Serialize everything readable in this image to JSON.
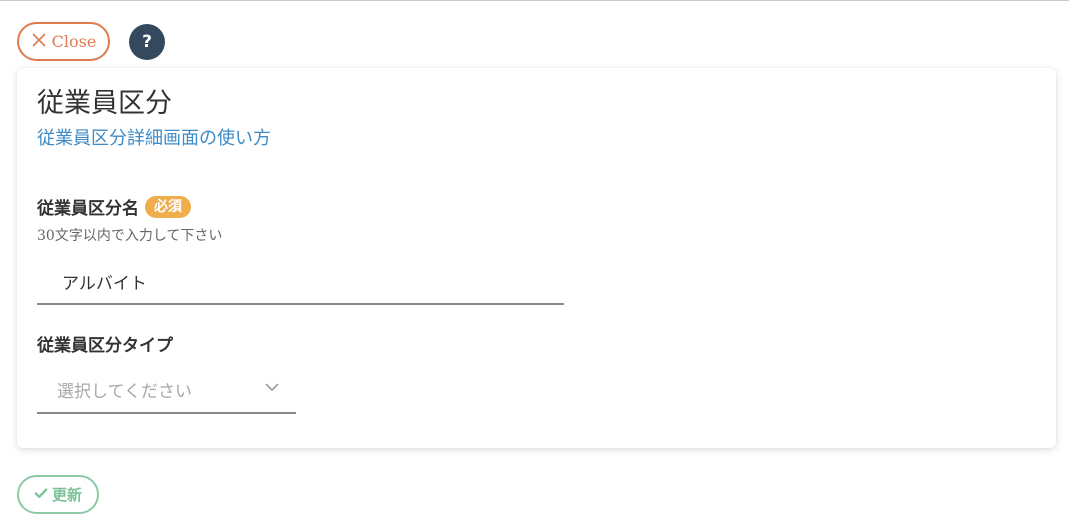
{
  "toolbar": {
    "close_label": "Close",
    "help_label": "?"
  },
  "page": {
    "title": "従業員区分",
    "help_link": "従業員区分詳細画面の使い方"
  },
  "form": {
    "name_field": {
      "label": "従業員区分名",
      "required_badge": "必須",
      "hint": "30文字以内で入力して下さい",
      "value": "アルバイト"
    },
    "type_field": {
      "label": "従業員区分タイプ",
      "placeholder": "選択してください"
    }
  },
  "actions": {
    "update_label": "更新"
  },
  "colors": {
    "close_accent": "#e07a4f",
    "help_bg": "#34495e",
    "link": "#3d8bc7",
    "required_badge": "#efad4d",
    "update_accent": "#7cc297"
  },
  "icons": {
    "close": "x-icon",
    "help": "question-icon",
    "select": "chevron-down-icon",
    "update": "check-icon"
  }
}
